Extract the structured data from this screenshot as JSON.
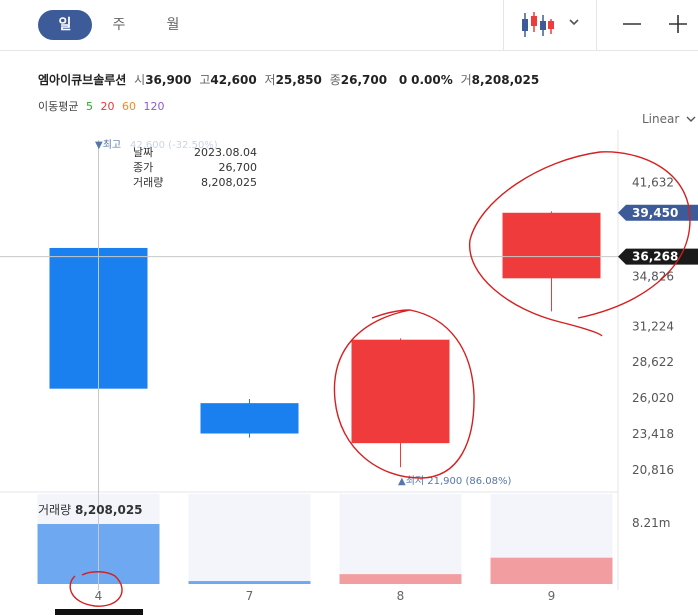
{
  "tabs": [
    {
      "label": "일",
      "active": true
    },
    {
      "label": "주",
      "active": false
    },
    {
      "label": "월",
      "active": false
    }
  ],
  "toolbar": {
    "chart_type_icon": "candlestick-icon",
    "dropdown_icon": "chevron-down-icon",
    "zoom_out_icon": "minus-icon",
    "zoom_in_icon": "plus-icon"
  },
  "stock": {
    "name": "엠아이큐브솔루션",
    "open_label": "시",
    "open": "36,900",
    "high_label": "고",
    "high": "42,600",
    "low_label": "저",
    "low": "25,850",
    "close_label": "종",
    "close": "26,700",
    "change": "0",
    "change_pct": "0.00%",
    "volume_label": "거",
    "volume": "8,208,025"
  },
  "moving_average": {
    "label": "이동평균",
    "periods": [
      {
        "value": "5",
        "color": "#22aa22"
      },
      {
        "value": "20",
        "color": "#e53935"
      },
      {
        "value": "60",
        "color": "#f08a24"
      },
      {
        "value": "120",
        "color": "#8a5cd1"
      }
    ]
  },
  "scale_mode": "Linear",
  "tooltip": {
    "rows": [
      {
        "key": "날짜",
        "value": "2023.08.04"
      },
      {
        "key": "종가",
        "value": "26,700"
      },
      {
        "key": "거래량",
        "value": "8,208,025"
      }
    ]
  },
  "annotations": {
    "high_marker": "▼최고",
    "high_marker_faded": "42,600 (-32.50%)",
    "low_marker": "▲최저 21,900 (86.08%)"
  },
  "volume_panel": {
    "label": "거래량",
    "value": "8,208,025",
    "axis_label": "8.21m"
  },
  "price_badges": {
    "upper": {
      "value": "39,450",
      "color": "#3d5a99"
    },
    "current": {
      "value": "36,268",
      "color": "#1a1a1a"
    }
  },
  "colors": {
    "up": "#ef3b3b",
    "down": "#1a7fef",
    "volume_up": "#f29ea0",
    "volume_down": "#6ea8f0",
    "volume_bg": "#f4f5fb",
    "accent": "#3d5a99"
  },
  "chart_data": {
    "type": "candlestick",
    "categories": [
      "4",
      "7",
      "8",
      "9"
    ],
    "candles": [
      {
        "x": "4",
        "open": 36900,
        "high": 42600,
        "low": 25850,
        "close": 26700,
        "direction": "down"
      },
      {
        "x": "7",
        "open": 25650,
        "high": 25950,
        "low": 23150,
        "close": 23450,
        "direction": "down"
      },
      {
        "x": "8",
        "open": 22750,
        "high": 30350,
        "low": 21000,
        "close": 30250,
        "direction": "up"
      },
      {
        "x": "9",
        "open": 34700,
        "high": 39550,
        "low": 32300,
        "close": 39450,
        "direction": "up"
      }
    ],
    "volume": [
      {
        "x": "4",
        "value": 8208025,
        "direction": "down"
      },
      {
        "x": "7",
        "value": 400000,
        "direction": "down"
      },
      {
        "x": "8",
        "value": 1350000,
        "direction": "up"
      },
      {
        "x": "9",
        "value": 3600000,
        "direction": "up"
      }
    ],
    "y_ticks": [
      "41,632",
      "34,826",
      "31,224",
      "28,622",
      "26,020",
      "23,418",
      "20,816"
    ],
    "ylim": [
      19500,
      44000
    ],
    "volume_max": 8210000,
    "crosshair_y": 36268,
    "crosshair_x": "4"
  }
}
